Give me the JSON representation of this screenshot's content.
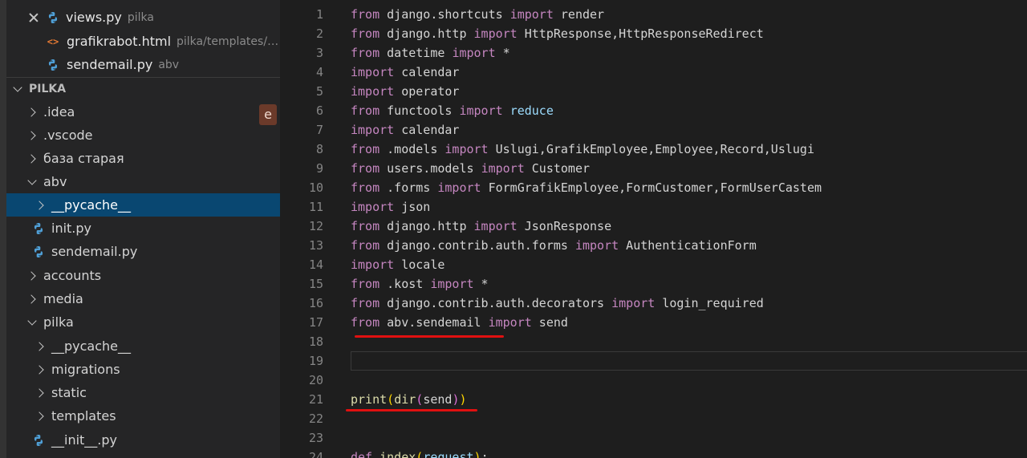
{
  "open_editors": [
    {
      "name": "views.py",
      "path": "pilka",
      "icon": "python-icon"
    },
    {
      "name": "grafikrabot.html",
      "path": "pilka/templates/p...",
      "icon": "html-icon"
    },
    {
      "name": "sendemail.py",
      "path": "abv",
      "icon": "python-icon"
    }
  ],
  "explorer": {
    "title": "PILKA",
    "badge": "e",
    "items": [
      {
        "label": ".idea"
      },
      {
        "label": ".vscode"
      },
      {
        "label": "база старая"
      },
      {
        "label": "abv"
      },
      {
        "label": "__pycache__"
      },
      {
        "label": "init.py"
      },
      {
        "label": "sendemail.py"
      },
      {
        "label": "accounts"
      },
      {
        "label": "media"
      },
      {
        "label": "pilka"
      },
      {
        "label": "__pycache__"
      },
      {
        "label": "migrations"
      },
      {
        "label": "static"
      },
      {
        "label": "templates"
      },
      {
        "label": "__init__.py"
      }
    ]
  },
  "colors": {
    "keyword": "#c586c0",
    "identifier": "#d4d4d4",
    "function": "#dcdcaa",
    "selection": "#094771",
    "annotation_red": "#e01010"
  },
  "editor": {
    "lines": [
      {
        "n": "1",
        "t": [
          [
            "kw",
            "from"
          ],
          [
            "",
            "django.shortcuts "
          ],
          [
            "kw",
            "import"
          ],
          [
            "",
            " render"
          ]
        ]
      },
      {
        "n": "2",
        "t": [
          [
            "kw",
            "from"
          ],
          [
            "",
            "django.http "
          ],
          [
            "kw",
            "import"
          ],
          [
            "",
            " HttpResponse,HttpResponseRedirect"
          ]
        ]
      },
      {
        "n": "3",
        "t": [
          [
            "kw",
            "from"
          ],
          [
            "",
            "datetime "
          ],
          [
            "kw",
            "import"
          ],
          [
            "",
            " *"
          ]
        ]
      },
      {
        "n": "4",
        "t": [
          [
            "kw",
            "import"
          ],
          [
            "",
            " calendar"
          ]
        ]
      },
      {
        "n": "5",
        "t": [
          [
            "kw",
            "import"
          ],
          [
            "",
            " operator"
          ]
        ]
      },
      {
        "n": "6",
        "t": [
          [
            "kw",
            "from"
          ],
          [
            "",
            "functools "
          ],
          [
            "kw",
            "import"
          ],
          [
            "",
            " "
          ],
          [
            "bl",
            "reduce"
          ]
        ]
      },
      {
        "n": "7",
        "t": [
          [
            "kw",
            "import"
          ],
          [
            "",
            " calendar"
          ]
        ]
      },
      {
        "n": "8",
        "t": [
          [
            "kw",
            "from"
          ],
          [
            "",
            ".models "
          ],
          [
            "kw",
            "import"
          ],
          [
            "",
            " Uslugi,GrafikEmployee,Employee,Record,Uslugi"
          ]
        ]
      },
      {
        "n": "9",
        "t": [
          [
            "kw",
            "from"
          ],
          [
            "",
            "users.models "
          ],
          [
            "kw",
            "import"
          ],
          [
            "",
            " Customer"
          ]
        ]
      },
      {
        "n": "10",
        "t": [
          [
            "kw",
            "from"
          ],
          [
            "",
            ".forms "
          ],
          [
            "kw",
            "import"
          ],
          [
            "",
            " FormGrafikEmployee,FormCustomer,FormUserCastem"
          ]
        ]
      },
      {
        "n": "11",
        "t": [
          [
            "kw",
            "import"
          ],
          [
            "",
            " json"
          ]
        ]
      },
      {
        "n": "12",
        "t": [
          [
            "kw",
            "from"
          ],
          [
            "",
            "django.http "
          ],
          [
            "kw",
            "import"
          ],
          [
            "",
            " JsonResponse"
          ]
        ]
      },
      {
        "n": "13",
        "t": [
          [
            "kw",
            "from"
          ],
          [
            "",
            "django.contrib.auth.forms "
          ],
          [
            "kw",
            "import"
          ],
          [
            "",
            " AuthenticationForm"
          ]
        ]
      },
      {
        "n": "14",
        "t": [
          [
            "kw",
            "import"
          ],
          [
            "",
            " locale"
          ]
        ]
      },
      {
        "n": "15",
        "t": [
          [
            "kw",
            "from"
          ],
          [
            "",
            ".kost "
          ],
          [
            "kw",
            "import"
          ],
          [
            "",
            " *"
          ]
        ]
      },
      {
        "n": "16",
        "t": [
          [
            "kw",
            "from"
          ],
          [
            "",
            "django.contrib.auth.decorators "
          ],
          [
            "kw",
            "import"
          ],
          [
            "",
            " login_required"
          ]
        ]
      },
      {
        "n": "17",
        "t": [
          [
            "kw",
            "from"
          ],
          [
            "",
            "abv.sendemail "
          ],
          [
            "kw",
            "import"
          ],
          [
            "",
            " send"
          ]
        ]
      },
      {
        "n": "18",
        "t": []
      },
      {
        "n": "19",
        "t": []
      },
      {
        "n": "20",
        "t": []
      },
      {
        "n": "21",
        "t": [
          [
            "fn",
            "print"
          ],
          [
            "pc",
            "("
          ],
          [
            "fn",
            "dir"
          ],
          [
            "pc2",
            "("
          ],
          [
            "",
            "send"
          ],
          [
            "pc2",
            ")"
          ],
          [
            "pc",
            ")"
          ]
        ]
      },
      {
        "n": "22",
        "t": []
      },
      {
        "n": "23",
        "t": []
      },
      {
        "n": "24",
        "t": [
          [
            "kw",
            "def"
          ],
          [
            "",
            " "
          ],
          [
            "fn",
            "index"
          ],
          [
            "pc",
            "("
          ],
          [
            "bl",
            "request"
          ],
          [
            "pc",
            ")"
          ],
          [
            "",
            ":"
          ]
        ]
      }
    ]
  }
}
